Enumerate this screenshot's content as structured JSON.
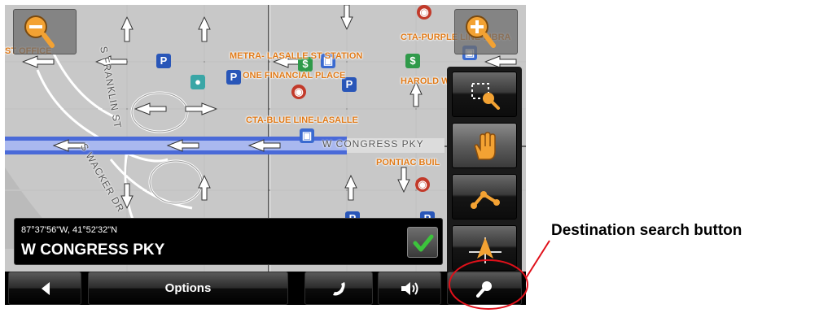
{
  "map": {
    "poi_labels": [
      {
        "id": "st-office",
        "text": "ST OFFICE"
      },
      {
        "id": "metra-lasalle",
        "text": "METRA- LASALLE ST STATION"
      },
      {
        "id": "one-financial",
        "text": "ONE FINANCIAL PLACE"
      },
      {
        "id": "cta-purple",
        "text": "CTA-PURPLE LINE-LIBRA"
      },
      {
        "id": "harold-w",
        "text": "HAROLD W"
      },
      {
        "id": "cta-blue",
        "text": "CTA-BLUE LINE-LASALLE"
      },
      {
        "id": "pontiac",
        "text": "PONTIAC BUIL"
      }
    ],
    "street_labels": [
      {
        "id": "s-franklin",
        "text": "S FRANKLIN ST"
      },
      {
        "id": "s-wacker",
        "text": "S WACKER DR"
      },
      {
        "id": "w-congress",
        "text": "W CONGRESS PKY"
      }
    ]
  },
  "info_bar": {
    "coordinates": "87°37'56\"W, 41°52'32\"N",
    "street": "W CONGRESS PKY"
  },
  "bottom_bar": {
    "options_label": "Options"
  },
  "annotation": {
    "text": "Destination search button",
    "color": "#e0101a"
  },
  "colors": {
    "map_background": "#c9c9c9",
    "poi_label": "#e07a18",
    "highway": "#4a6ad8",
    "confirm_check": "#3cc43c",
    "tool_orange": "#f3a233"
  },
  "icons": {
    "zoom_out": "zoom-out-icon",
    "zoom_in": "zoom-in-icon",
    "select_area": "select-area-zoom-icon",
    "pan": "hand-pan-icon",
    "route": "route-icon",
    "position": "position-arrow-icon",
    "confirm": "checkmark-icon",
    "back": "back-arrow-icon",
    "phone": "phone-icon",
    "volume": "volume-icon",
    "search": "search-icon"
  }
}
